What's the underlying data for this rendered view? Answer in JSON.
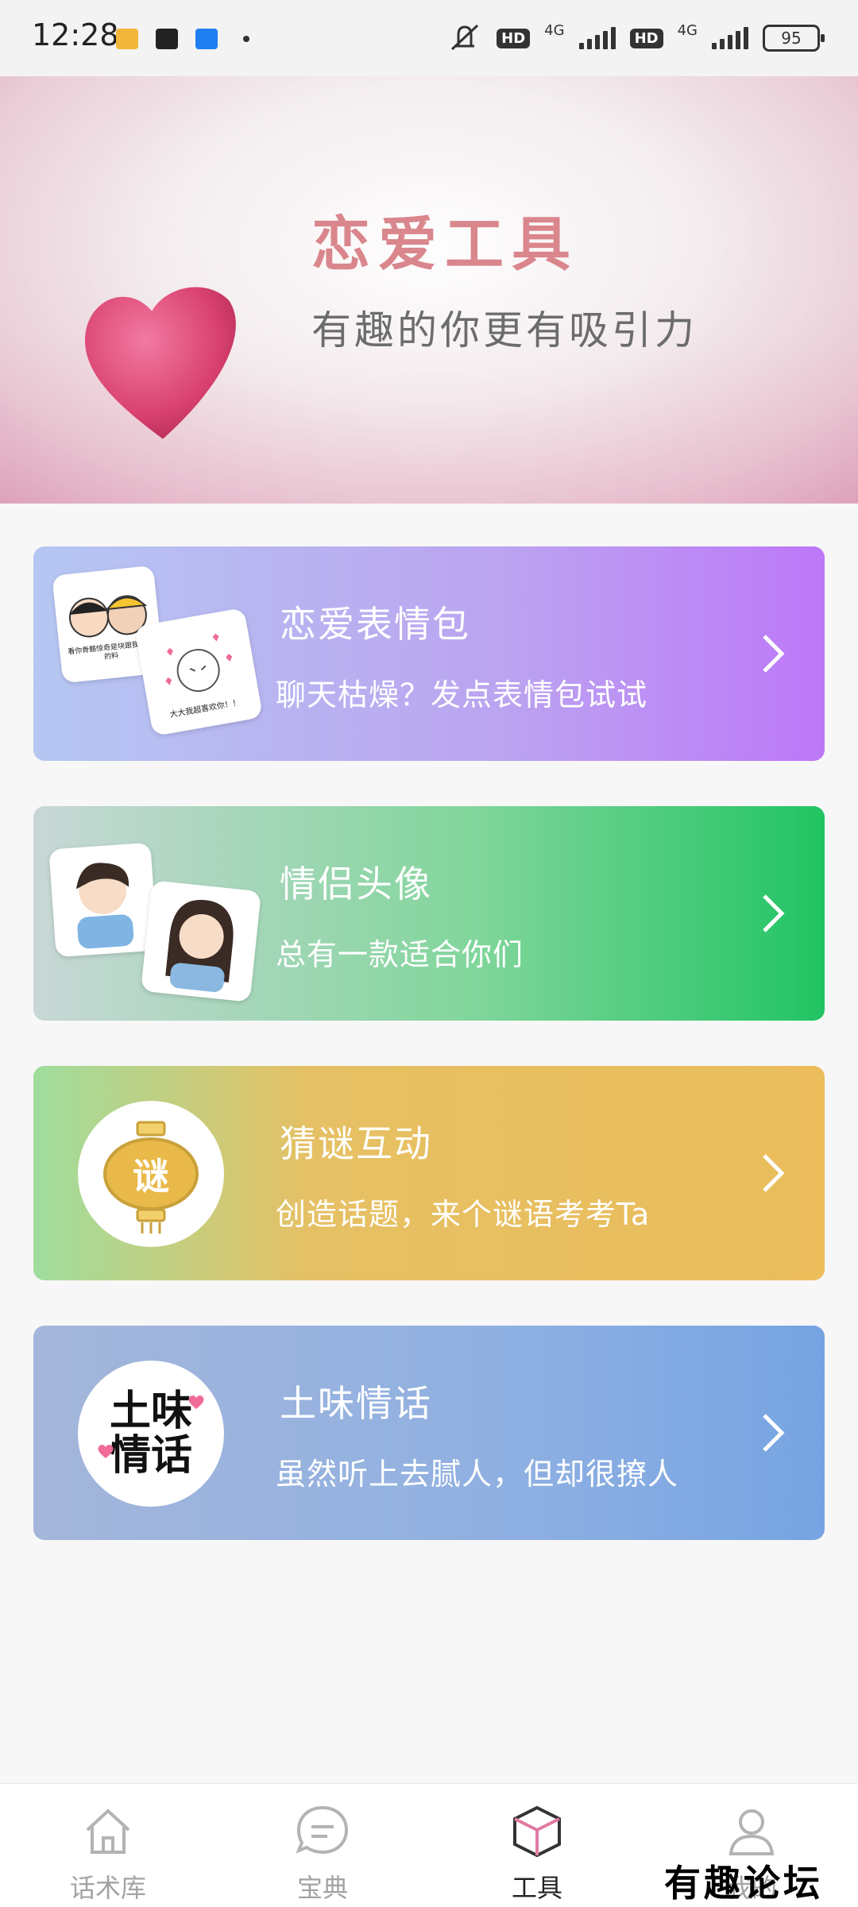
{
  "status_bar": {
    "time": "12:28",
    "network_label_1": "4G",
    "network_label_2": "4G",
    "hd_label": "HD",
    "battery": "95",
    "notification_icons": [
      "mail-icon",
      "dewu-icon",
      "zhihu-icon"
    ]
  },
  "banner": {
    "title": "恋爱工具",
    "subtitle": "有趣的你更有吸引力"
  },
  "tools": [
    {
      "label": "恋爱表情包",
      "desc": "聊天枯燥？发点表情包试试",
      "icon": "emoji-stickers"
    },
    {
      "label": "情侣头像",
      "desc": "总有一款适合你们",
      "icon": "couple-avatars"
    },
    {
      "label": "猜谜互动",
      "desc": "创造话题，来个谜语考考Ta",
      "icon": "riddle-lantern",
      "icon_text": "谜"
    },
    {
      "label": "土味情话",
      "desc": "虽然听上去腻人，但却很撩人",
      "icon": "love-words-calligraphy",
      "icon_text_1": "土味",
      "icon_text_2": "情话"
    }
  ],
  "sticker_captions": {
    "left": "看你骨骼惊奇是块跟我恋爱的料",
    "right": "大大我超喜欢你！！"
  },
  "tabbar": {
    "items": [
      {
        "label": "话术库",
        "icon": "home-icon"
      },
      {
        "label": "宝典",
        "icon": "chat-bubble-icon"
      },
      {
        "label": "工具",
        "icon": "cube-icon",
        "active": true
      },
      {
        "label": "我的",
        "icon": "user-icon"
      }
    ]
  },
  "watermark": "有趣论坛",
  "colors": {
    "banner_title": "#d9868c",
    "card1": "#bd78f8",
    "card2": "#21c463",
    "card3": "#ebbd5b",
    "card4": "#76a4e2",
    "active_tab_accent": "#e27aa3"
  }
}
